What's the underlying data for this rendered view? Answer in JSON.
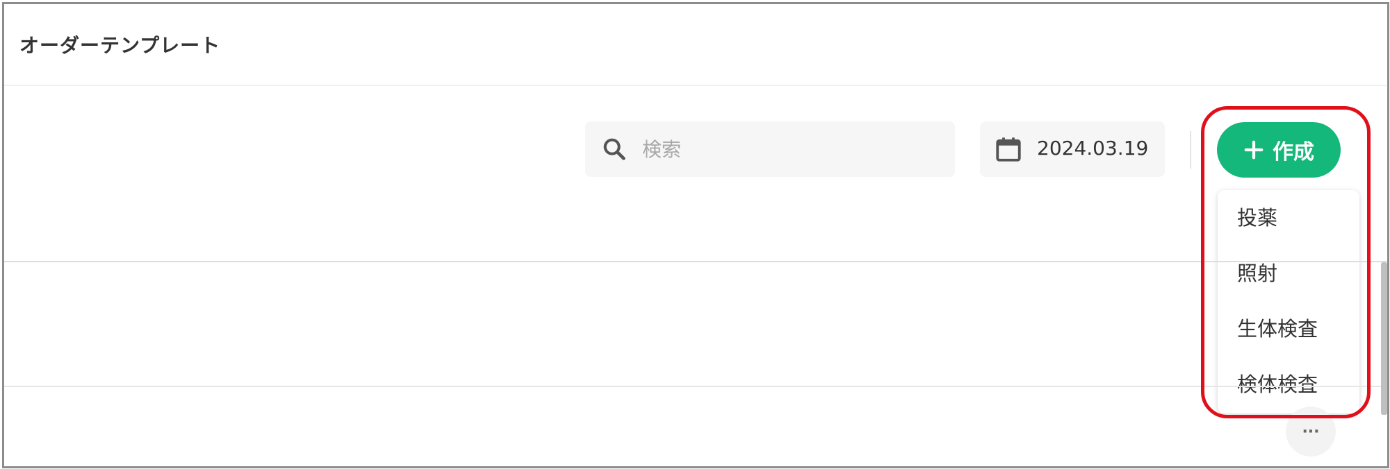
{
  "page": {
    "title": "オーダーテンプレート"
  },
  "search": {
    "placeholder": "検索",
    "value": "",
    "icon": "search-icon"
  },
  "date_filter": {
    "value": "2024.03.19",
    "icon": "calendar-icon"
  },
  "create_button": {
    "label": "作成",
    "icon": "plus-icon",
    "color": "#13b87a"
  },
  "create_menu": {
    "items": [
      {
        "label": "投薬"
      },
      {
        "label": "照射"
      },
      {
        "label": "生体検査"
      },
      {
        "label": "検体検査"
      }
    ]
  },
  "row_actions": {
    "more_icon": "more-horizontal-icon",
    "label": "···"
  },
  "annotation": {
    "highlight_color": "#e0101a"
  }
}
